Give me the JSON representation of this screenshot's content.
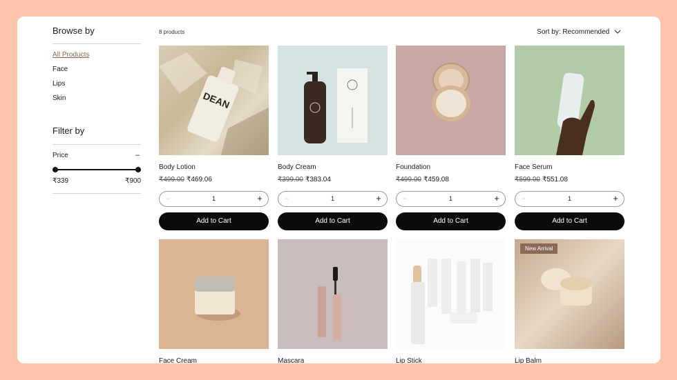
{
  "sidebar": {
    "browse_title": "Browse by",
    "categories": [
      {
        "label": "All Products",
        "active": true
      },
      {
        "label": "Face",
        "active": false
      },
      {
        "label": "Lips",
        "active": false
      },
      {
        "label": "Skin",
        "active": false
      }
    ],
    "filter_title": "Filter by",
    "price_label": "Price",
    "collapse_symbol": "–",
    "price_min": "₹339",
    "price_max": "₹900"
  },
  "toolbar": {
    "product_count": "8 products",
    "sort_label": "Sort by: Recommended"
  },
  "products": [
    {
      "name": "Body Lotion",
      "old_price": "₹499.00",
      "price": "₹469.06",
      "qty": "1",
      "cart_label": "Add to Cart",
      "image": "lotion-bottle-on-rocks"
    },
    {
      "name": "Body Cream",
      "old_price": "₹399.00",
      "price": "₹383.04",
      "qty": "1",
      "cart_label": "Add to Cart",
      "image": "pump-bottle-with-box"
    },
    {
      "name": "Foundation",
      "old_price": "₹499.00",
      "price": "₹459.08",
      "qty": "1",
      "cart_label": "Add to Cart",
      "image": "compact-powder"
    },
    {
      "name": "Face Serum",
      "old_price": "₹599.00",
      "price": "₹551.08",
      "qty": "1",
      "cart_label": "Add to Cart",
      "image": "hand-holding-tube"
    },
    {
      "name": "Face Cream",
      "image": "cream-jar"
    },
    {
      "name": "Mascara",
      "image": "mascara-wand"
    },
    {
      "name": "Lip Stick",
      "image": "white-lipsticks"
    },
    {
      "name": "Lip Balm",
      "badge": "New Arrival",
      "image": "lip-balm-jar"
    }
  ],
  "labels": {
    "qty_minus": "−",
    "qty_plus": "+"
  },
  "colors": {
    "page_background": "#fdc4ab",
    "accent_link": "#8a6450",
    "button_bg": "#0b0b0b",
    "badge_bg": "#8b6b58"
  }
}
